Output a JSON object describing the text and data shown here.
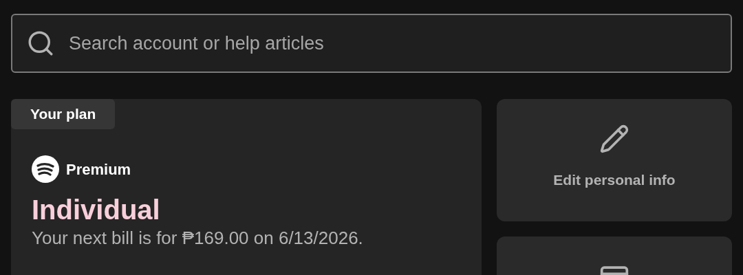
{
  "search": {
    "placeholder": "Search account or help articles"
  },
  "plan": {
    "tag": "Your plan",
    "brand": "Premium",
    "name": "Individual",
    "billing": "Your next bill is for ₱169.00 on 6/13/2026."
  },
  "shortcuts": [
    {
      "kind": "edit",
      "label": "Edit personal info"
    },
    {
      "kind": "payment"
    }
  ]
}
